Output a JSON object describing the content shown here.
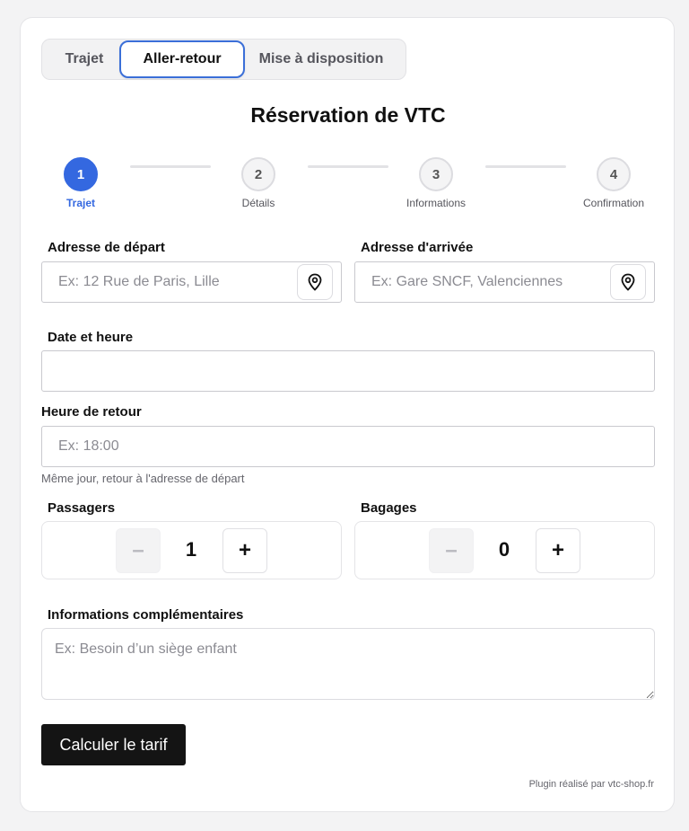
{
  "tabs": [
    {
      "label": "Trajet",
      "active": false
    },
    {
      "label": "Aller-retour",
      "active": true
    },
    {
      "label": "Mise à disposition",
      "active": false
    }
  ],
  "title": "Réservation de VTC",
  "steps": [
    {
      "number": "1",
      "label": "Trajet",
      "active": true
    },
    {
      "number": "2",
      "label": "Détails",
      "active": false
    },
    {
      "number": "3",
      "label": "Informations",
      "active": false
    },
    {
      "number": "4",
      "label": "Confirmation",
      "active": false
    }
  ],
  "departure": {
    "label": "Adresse de départ",
    "placeholder": "Ex: 12 Rue de Paris, Lille",
    "icon": "location-pin-icon"
  },
  "arrival": {
    "label": "Adresse d'arrivée",
    "placeholder": "Ex: Gare SNCF, Valenciennes",
    "icon": "location-pin-icon"
  },
  "datetime": {
    "label": "Date et heure",
    "value": ""
  },
  "return_time": {
    "label": "Heure de retour",
    "placeholder": "Ex: 18:00",
    "help": "Même jour, retour à l'adresse de départ"
  },
  "passengers": {
    "label": "Passagers",
    "value": "1",
    "minus": "–",
    "plus": "+"
  },
  "luggage": {
    "label": "Bagages",
    "value": "0",
    "minus": "–",
    "plus": "+"
  },
  "extra_info": {
    "label": "Informations complémentaires",
    "placeholder": "Ex: Besoin d’un siège enfant"
  },
  "submit_label": "Calculer le tarif",
  "footer": "Plugin réalisé par vtc-shop.fr",
  "colors": {
    "accent": "#3468e0",
    "button": "#141414"
  }
}
